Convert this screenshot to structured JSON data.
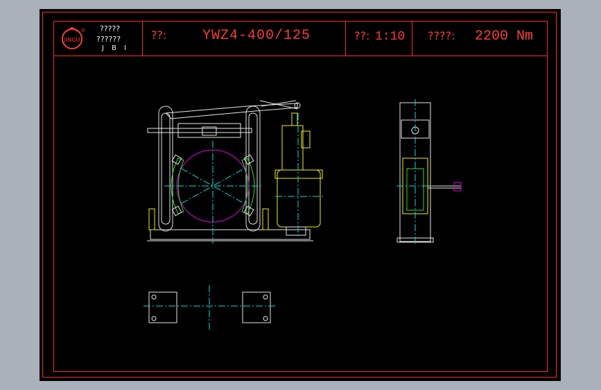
{
  "title_block": {
    "company_line1": "?????",
    "company_line2": "??????",
    "company_line3": "J B I",
    "logo_text": "JINGU",
    "logo_mark": "®",
    "model_label": "??:",
    "model_value": "YWZ4-400/125",
    "scale_label": "??:",
    "scale_value": "1:10",
    "torque_label": "????:",
    "torque_value": "2200 Nm"
  },
  "colors": {
    "background": "#000000",
    "border": "#ff2a2a",
    "text": "#ff3a3a",
    "line_white": "#e8e8e8",
    "line_yellow": "#f5f500",
    "line_cyan": "#00e0e0",
    "line_magenta": "#e000e0",
    "line_green": "#30e030"
  },
  "icons": {
    "logo": "jingu-logo-icon"
  }
}
